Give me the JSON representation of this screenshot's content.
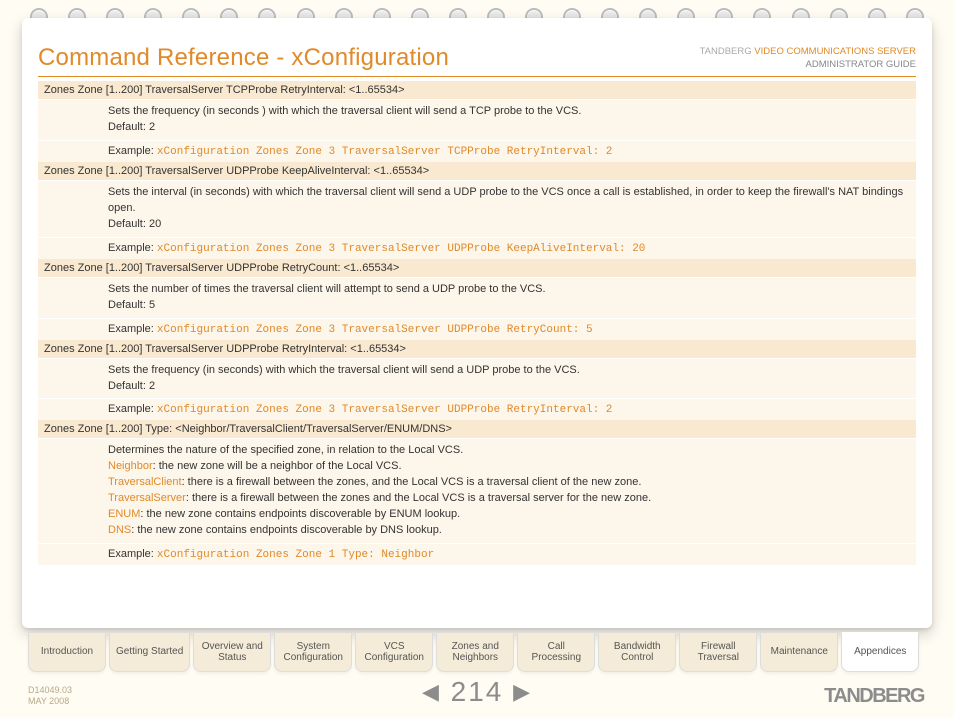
{
  "header": {
    "title": "Command Reference - xConfiguration",
    "brand": "TANDBERG",
    "product": "VIDEO COMMUNICATIONS SERVER",
    "guide": "ADMINISTRATOR GUIDE"
  },
  "commands": [
    {
      "name": "Zones Zone [1..200] TraversalServer TCPProbe RetryInterval: <1..65534>",
      "description": "Sets the frequency (in seconds ) with which the traversal client will send a TCP probe to the VCS.",
      "default": "Default: 2",
      "example_label": "Example:",
      "example_code": "xConfiguration Zones Zone 3 TraversalServer TCPProbe RetryInterval: 2"
    },
    {
      "name": "Zones Zone [1..200] TraversalServer UDPProbe KeepAliveInterval: <1..65534>",
      "description": "Sets the interval (in seconds) with which the traversal client will send a UDP probe to the VCS once a call is established, in order to keep the firewall's NAT bindings open.",
      "default": "Default: 20",
      "example_label": "Example:",
      "example_code": "xConfiguration Zones Zone 3 TraversalServer UDPProbe KeepAliveInterval: 20"
    },
    {
      "name": "Zones Zone [1..200] TraversalServer UDPProbe RetryCount: <1..65534>",
      "description": "Sets the number of times the traversal client will attempt to send a UDP probe to the VCS.",
      "default": "Default: 5",
      "example_label": "Example:",
      "example_code": "xConfiguration Zones Zone 3 TraversalServer UDPProbe RetryCount: 5"
    },
    {
      "name": "Zones Zone [1..200] TraversalServer UDPProbe RetryInterval: <1..65534>",
      "description": "Sets the frequency (in seconds) with which the traversal client will send a UDP probe to the VCS.",
      "default": "Default: 2",
      "example_label": "Example:",
      "example_code": "xConfiguration Zones Zone 3 TraversalServer UDPProbe RetryInterval: 2"
    },
    {
      "name": "Zones Zone [1..200] Type: <Neighbor/TraversalClient/TraversalServer/ENUM/DNS>",
      "description_intro": "Determines the nature of the specified zone, in relation to the Local VCS.",
      "options": [
        {
          "key": "Neighbor",
          "text": ": the new zone will be a neighbor of the Local VCS."
        },
        {
          "key": "TraversalClient",
          "text": ": there is a firewall between the zones, and the Local VCS is a traversal client of the new zone."
        },
        {
          "key": "TraversalServer",
          "text": ": there is a firewall between the zones and the Local VCS is a traversal server for the new zone."
        },
        {
          "key": "ENUM",
          "text": ": the new zone contains endpoints discoverable by ENUM lookup."
        },
        {
          "key": "DNS",
          "text": ": the new zone contains endpoints discoverable by DNS lookup."
        }
      ],
      "example_label": "Example:",
      "example_code": "xConfiguration Zones Zone 1 Type: Neighbor"
    }
  ],
  "tabs": [
    {
      "label": "Introduction"
    },
    {
      "label": "Getting Started"
    },
    {
      "label": "Overview and",
      "label2": "Status"
    },
    {
      "label": "System",
      "label2": "Configuration"
    },
    {
      "label": "VCS",
      "label2": "Configuration"
    },
    {
      "label": "Zones and",
      "label2": "Neighbors"
    },
    {
      "label": "Call",
      "label2": "Processing"
    },
    {
      "label": "Bandwidth",
      "label2": "Control"
    },
    {
      "label": "Firewall",
      "label2": "Traversal"
    },
    {
      "label": "Maintenance"
    },
    {
      "label": "Appendices",
      "active": true
    }
  ],
  "footer": {
    "docnum": "D14049.03",
    "date": "MAY 2008",
    "page": "214",
    "logo": "TANDBERG"
  }
}
